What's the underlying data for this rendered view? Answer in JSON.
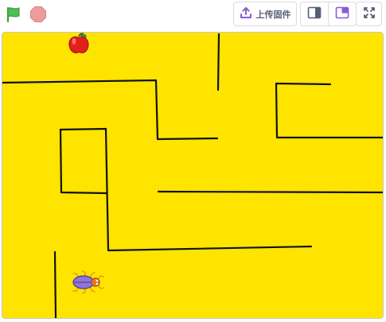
{
  "toolbar": {
    "green_flag_icon": "green-flag-icon",
    "stop_icon": "stop-sign-icon",
    "upload_label": "上传固件",
    "upload_icon": "upload-icon",
    "small_stage_icon": "small-stage-layout-icon",
    "large_stage_icon": "large-stage-layout-icon",
    "fullscreen_icon": "fullscreen-icon"
  },
  "stage": {
    "background_color": "#ffe400",
    "wall_color": "#111111",
    "sprites": [
      {
        "name": "apple",
        "icon": "apple-sprite"
      },
      {
        "name": "beetle",
        "icon": "beetle-sprite"
      }
    ]
  },
  "colors": {
    "flag_green": "#4cbf56",
    "stop_red": "#ec9c9c",
    "accent_purple": "#855cd6",
    "toolbar_text": "#575e75"
  }
}
